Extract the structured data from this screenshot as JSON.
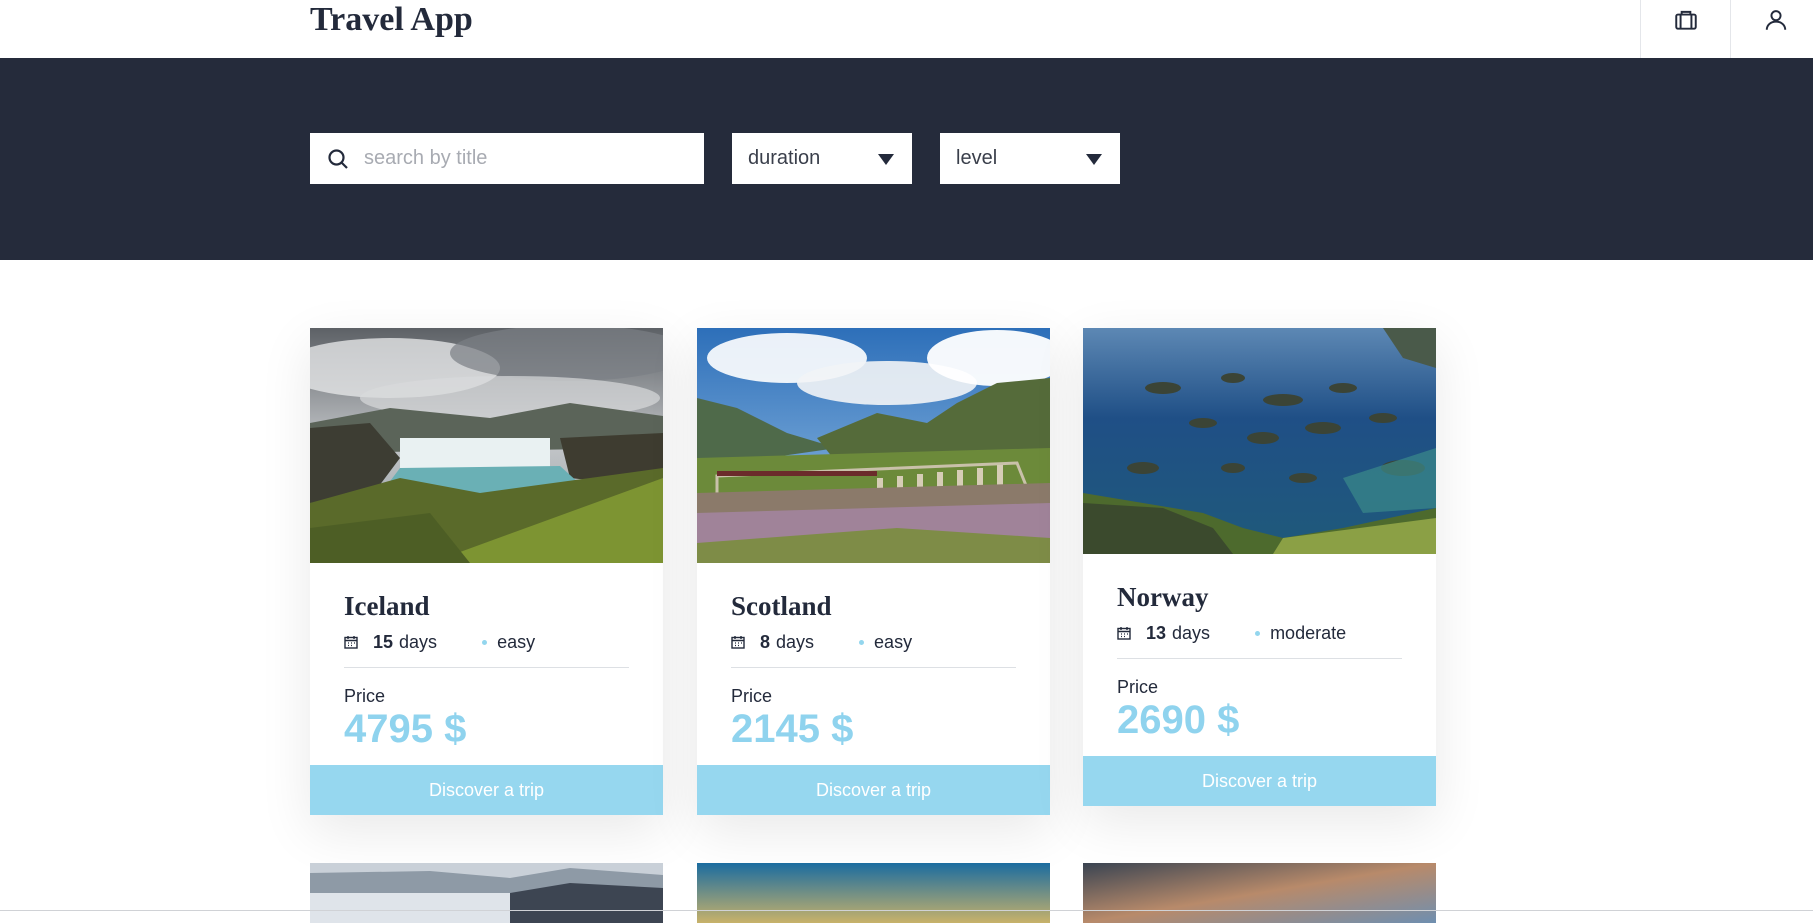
{
  "header": {
    "title": "Travel App",
    "bookings_icon": "briefcase-icon",
    "profile_icon": "user-icon"
  },
  "filters": {
    "search_placeholder": "search by title",
    "search_value": "",
    "duration_label": "duration",
    "level_label": "level"
  },
  "colors": {
    "header_bg": "#ffffff",
    "filter_bar_bg": "#252b3b",
    "accent": "#96d7ef",
    "price_color": "#8fd3ee",
    "text_dark": "#232a3b"
  },
  "trips": [
    {
      "title": "Iceland",
      "days": "15",
      "days_unit": "days",
      "level": "easy",
      "price_label": "Price",
      "price": "4795 $",
      "button": "Discover a trip",
      "image": "waterfall-landscape"
    },
    {
      "title": "Scotland",
      "days": "8",
      "days_unit": "days",
      "level": "easy",
      "price_label": "Price",
      "price": "2145 $",
      "button": "Discover a trip",
      "image": "viaduct-train-landscape"
    },
    {
      "title": "Norway",
      "days": "13",
      "days_unit": "days",
      "level": "moderate",
      "price_label": "Price",
      "price": "2690 $",
      "button": "Discover a trip",
      "image": "fjord-islands-landscape"
    }
  ]
}
